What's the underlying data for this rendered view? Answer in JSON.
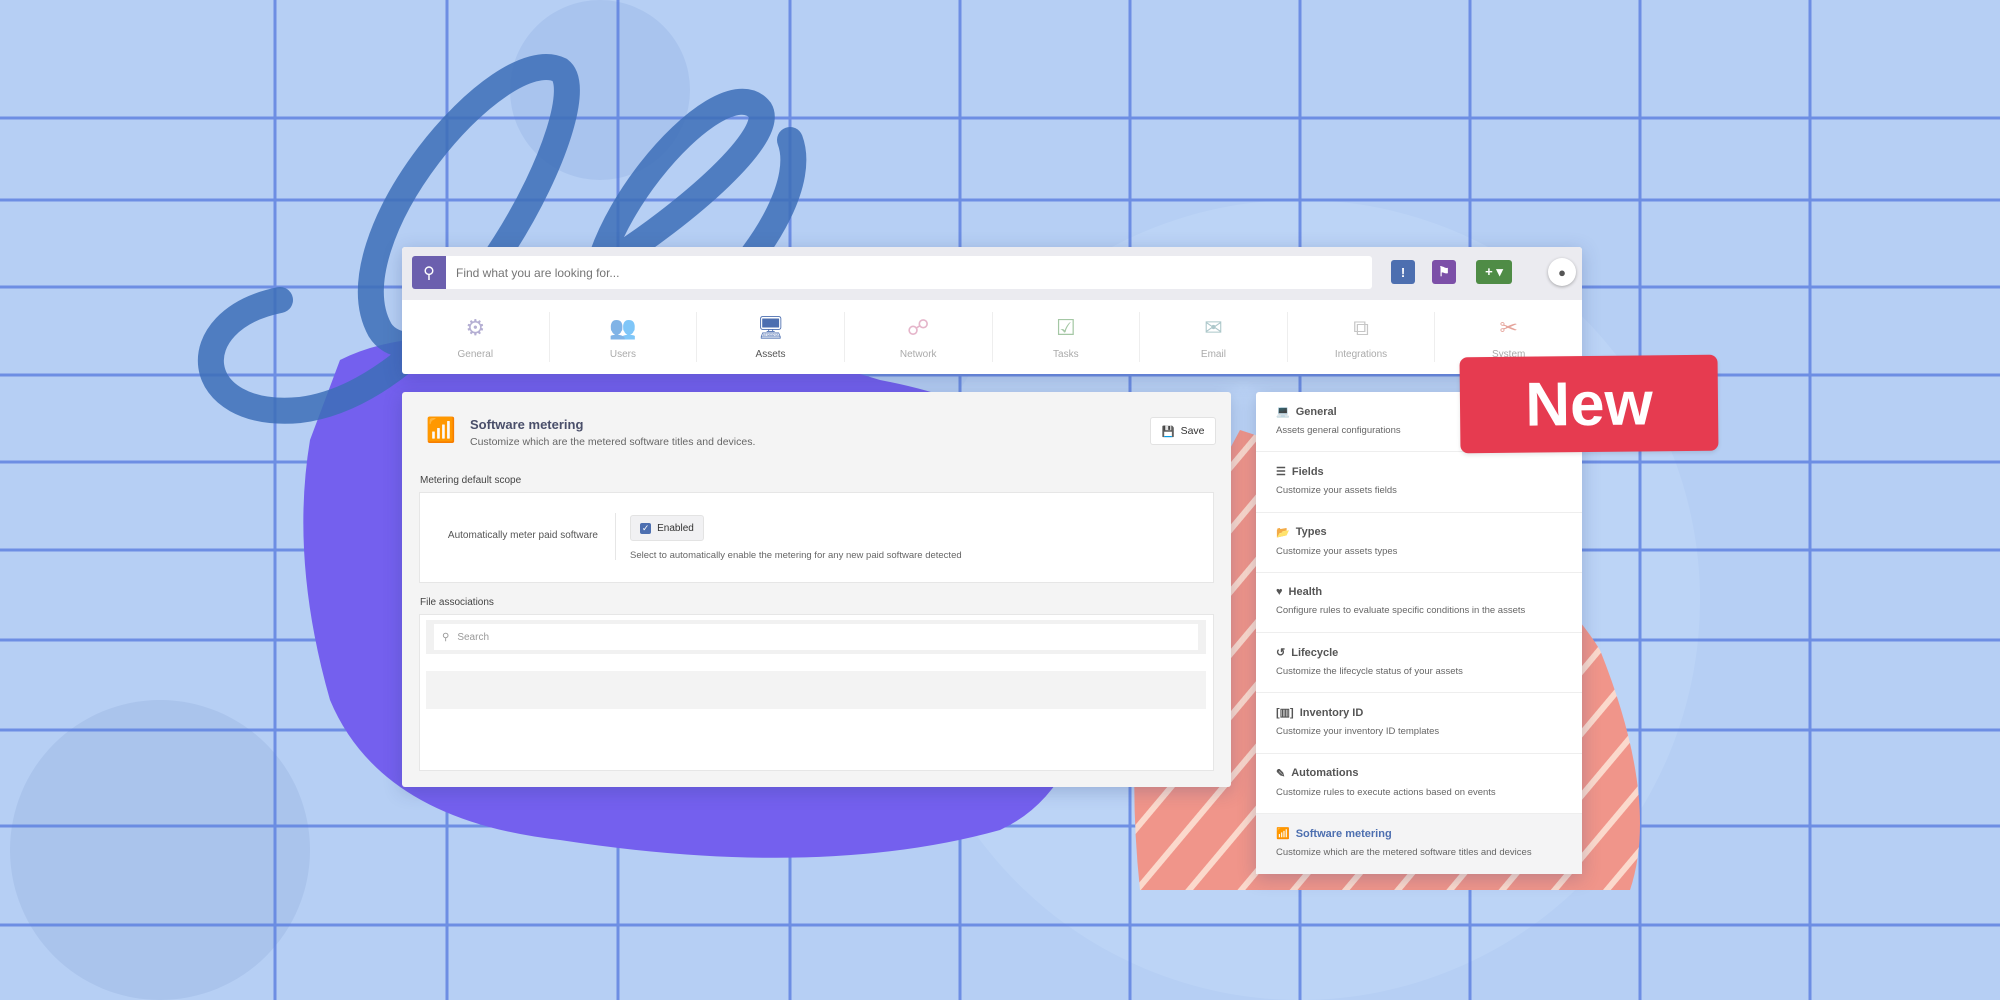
{
  "colors": {
    "accent": "#4d6fb0",
    "search": "#6b5fae",
    "badge": "#e63b50",
    "info": "#4d6fb0",
    "tag": "#7c4fa8",
    "add": "#4f8c46"
  },
  "search": {
    "placeholder": "Find what you are looking for..."
  },
  "nav": [
    {
      "label": "General",
      "icon": "gears-icon"
    },
    {
      "label": "Users",
      "icon": "users-icon"
    },
    {
      "label": "Assets",
      "icon": "assets-icon"
    },
    {
      "label": "Network",
      "icon": "network-icon"
    },
    {
      "label": "Tasks",
      "icon": "tasks-icon"
    },
    {
      "label": "Email",
      "icon": "email-icon"
    },
    {
      "label": "Integrations",
      "icon": "integrations-icon"
    },
    {
      "label": "System",
      "icon": "tools-icon"
    }
  ],
  "page": {
    "title": "Software metering",
    "subtitle": "Customize which are the metered software titles and devices.",
    "save": "Save"
  },
  "scope": {
    "heading": "Metering default scope",
    "label": "Automatically meter paid software",
    "checkbox": "Enabled",
    "checked": true,
    "help": "Select to automatically enable the metering for any new paid software detected"
  },
  "files": {
    "heading": "File associations",
    "search_placeholder": "Search"
  },
  "menu": [
    {
      "title": "General",
      "desc": "Assets general configurations",
      "icon": "laptop-icon"
    },
    {
      "title": "Fields",
      "desc": "Customize your assets fields",
      "icon": "list-icon"
    },
    {
      "title": "Types",
      "desc": "Customize your assets types",
      "icon": "folder-icon"
    },
    {
      "title": "Health",
      "desc": "Configure rules to evaluate specific conditions in the assets",
      "icon": "heartbeat-icon"
    },
    {
      "title": "Lifecycle",
      "desc": "Customize the lifecycle status of your assets",
      "icon": "history-icon"
    },
    {
      "title": "Inventory ID",
      "desc": "Customize your inventory ID templates",
      "icon": "barcode-icon"
    },
    {
      "title": "Automations",
      "desc": "Customize rules to execute actions based on events",
      "icon": "magic-icon"
    },
    {
      "title": "Software metering",
      "desc": "Customize which are the metered software titles and devices",
      "icon": "chart-icon"
    }
  ],
  "badge": "New"
}
